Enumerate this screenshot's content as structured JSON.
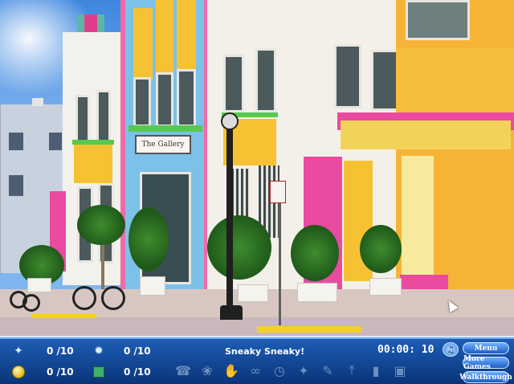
{
  "game": {
    "title": "Sneaky Sneaky!",
    "timer": "00:00: 10",
    "counters": [
      {
        "icon": "bird-icon",
        "value": "0 /10"
      },
      {
        "icon": "gear-icon",
        "value": "0 /10"
      },
      {
        "icon": "coin-icon",
        "value": "0 /10"
      },
      {
        "icon": "box-icon",
        "value": "0 /10"
      }
    ],
    "buttons": {
      "menu": "Menu",
      "more_games": "More Games",
      "walkthrough": "Walkthrough"
    },
    "shadow_items": [
      "phone-icon",
      "bird-shape-icon",
      "hand-icon",
      "glasses-icon",
      "clock-icon",
      "star-icon",
      "pen-icon",
      "knife-icon",
      "box-icon",
      "book-icon"
    ]
  },
  "scene": {
    "sign_text": "The Gallery",
    "colors": {
      "pink": "#ea4aa0",
      "yellow": "#f6c233",
      "blue": "#7cc1ea",
      "orange": "#f6b437",
      "green": "#57c94c"
    }
  }
}
